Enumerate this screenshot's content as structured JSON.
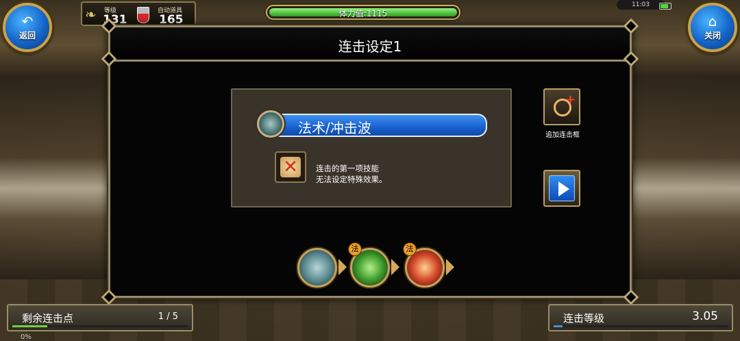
{
  "hud": {
    "back_label": "返回",
    "close_label": "关闭",
    "level_label": "等级",
    "level_value": "131",
    "auto_label": "自动道具",
    "auto_value": "165",
    "stamina_text": "体力值:1115",
    "stamina_fraction": 1.0,
    "time": "11:03",
    "battery_fraction": 0.8
  },
  "dialog": {
    "title": "连击设定1",
    "skill_name": "法术/冲击波",
    "note_line1": "连击的第一项技能",
    "note_line2": "无法设定特殊效果。",
    "add_label": "追加连击框"
  },
  "chain": {
    "items": [
      {
        "icon": "spirit-figure-icon",
        "badge": ""
      },
      {
        "icon": "green-slash-icon",
        "badge": "法"
      },
      {
        "icon": "red-dome-icon",
        "badge": "法"
      }
    ]
  },
  "bottom": {
    "remain_label": "剩余连击点",
    "remain_value": "1 / 5",
    "remain_fraction": 0.2,
    "combo_level_label": "连击等级",
    "combo_level_value": "3.05",
    "combo_level_fraction": 0.05,
    "percent_text": "0%"
  },
  "colors": {
    "accent_blue": "#1861cf",
    "frame_gold": "#9a8c6a",
    "stamina_green": "#2f9c23"
  }
}
